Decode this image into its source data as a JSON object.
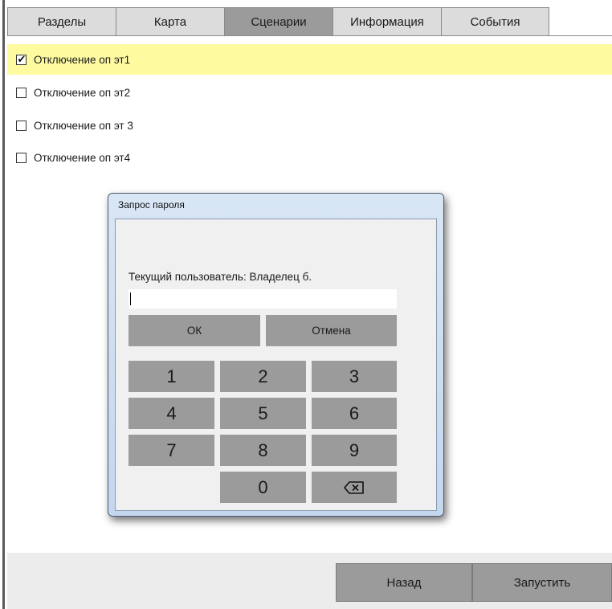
{
  "tabs": [
    {
      "label": "Разделы",
      "active": false
    },
    {
      "label": "Карта",
      "active": false
    },
    {
      "label": "Сценарии",
      "active": true
    },
    {
      "label": "Информация",
      "active": false
    },
    {
      "label": "События",
      "active": false
    }
  ],
  "scenarios": [
    {
      "label": "Отключение оп эт1",
      "checked": true,
      "selected": true
    },
    {
      "label": "Отключение оп эт2",
      "checked": false,
      "selected": false
    },
    {
      "label": "Отключение оп эт 3",
      "checked": false,
      "selected": false
    },
    {
      "label": "Отключение оп эт4",
      "checked": false,
      "selected": false
    }
  ],
  "dialog": {
    "title": "Запрос пароля",
    "user_label": "Текущий пользователь: Владелец б.",
    "password_value": "",
    "ok_label": "ОК",
    "cancel_label": "Отмена",
    "keys": [
      "1",
      "2",
      "3",
      "4",
      "5",
      "6",
      "7",
      "8",
      "9",
      "0"
    ],
    "backspace_icon": "backspace-icon"
  },
  "footer": {
    "back_label": "Назад",
    "run_label": "Запустить"
  },
  "colors": {
    "selected_row": "#fdfaa0",
    "active_tab": "#9b9b9b",
    "inactive_tab": "#dcdcdc",
    "button": "#9b9b9b",
    "dialog_frame": "#c4d7ee"
  }
}
